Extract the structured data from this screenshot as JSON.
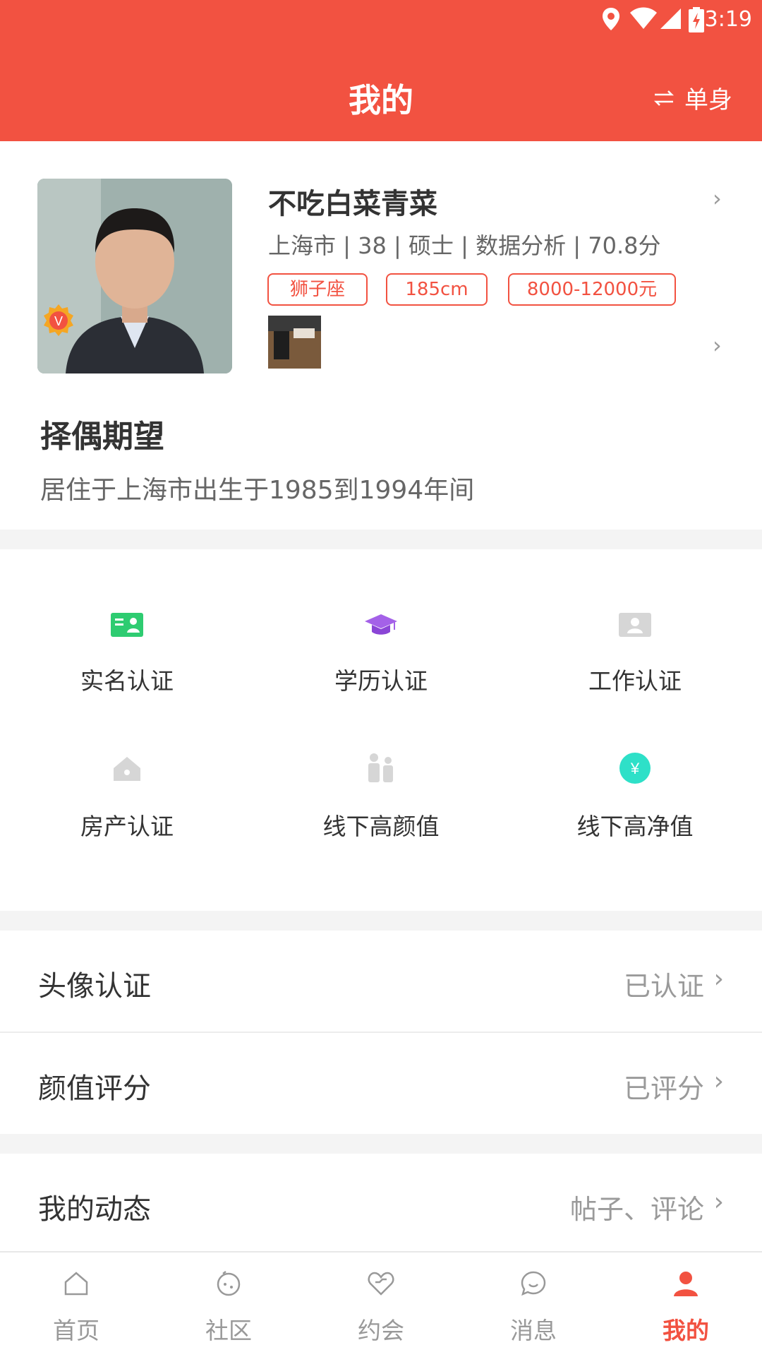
{
  "status_bar": {
    "time": "3:19"
  },
  "header": {
    "title": "我的",
    "switch_label": "单身"
  },
  "profile": {
    "name": "不吃白菜青菜",
    "meta": "上海市 | 38 | 硕士 | 数据分析 | 70.8分",
    "tags": [
      "狮子座",
      "185cm",
      "8000-12000元"
    ],
    "badge": "V"
  },
  "expectation": {
    "title": "择偶期望",
    "text": "居住于上海市出生于1985到1994年间"
  },
  "verifications": [
    {
      "label": "实名认证",
      "icon": "id-card-icon",
      "color": "#2ecc71"
    },
    {
      "label": "学历认证",
      "icon": "graduation-cap-icon",
      "color": "#a461e8"
    },
    {
      "label": "工作认证",
      "icon": "work-card-icon",
      "color": "#cccccc"
    },
    {
      "label": "房产认证",
      "icon": "house-icon",
      "color": "#cccccc"
    },
    {
      "label": "线下高颜值",
      "icon": "people-icon",
      "color": "#cccccc"
    },
    {
      "label": "线下高净值",
      "icon": "yen-coin-icon",
      "color": "#2ee0c8"
    }
  ],
  "list": [
    {
      "label": "头像认证",
      "value": "已认证"
    },
    {
      "label": "颜值评分",
      "value": "已评分"
    },
    {
      "label": "我的动态",
      "value": "帖子、评论"
    }
  ],
  "nav": [
    {
      "label": "首页",
      "icon": "home-icon",
      "active": false
    },
    {
      "label": "社区",
      "icon": "community-icon",
      "active": false
    },
    {
      "label": "约会",
      "icon": "heart-icon",
      "active": false
    },
    {
      "label": "消息",
      "icon": "message-icon",
      "active": false
    },
    {
      "label": "我的",
      "icon": "person-icon",
      "active": true
    }
  ],
  "colors": {
    "brand": "#f25241",
    "inactive": "#999999"
  }
}
